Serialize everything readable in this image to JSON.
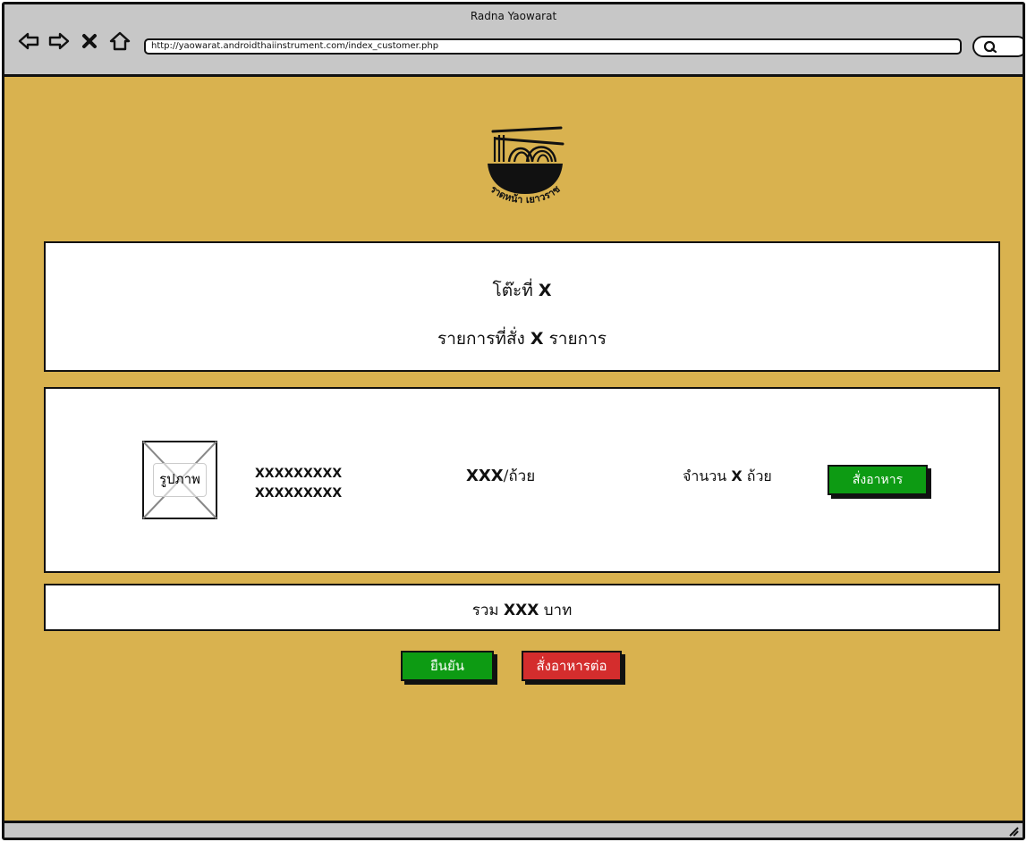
{
  "window": {
    "title": "Radna Yaowarat",
    "url": "http://yaowarat.androidthaiinstrument.com/index_customer.php"
  },
  "logo": {
    "text": "ราดหน้า เยาวราช",
    "icon": "noodle-bowl-icon"
  },
  "summary": {
    "table_prefix": "โต๊ะที่",
    "table_value": "X",
    "items_prefix": "รายการที่สั่ง",
    "items_value": "X",
    "items_suffix": "รายการ"
  },
  "order_item": {
    "image_label": "รูปภาพ",
    "name_line1": "XXXXXXXXX",
    "name_line2": "XXXXXXXXX",
    "price_value": "XXX",
    "price_unit": "/ถ้วย",
    "qty_prefix": "จำนวน",
    "qty_value": "X",
    "qty_suffix": "ถ้วย",
    "order_button": "สั่งอาหาร"
  },
  "total": {
    "prefix": "รวม",
    "value": "XXX",
    "suffix": "บาท"
  },
  "actions": {
    "confirm": "ยืนยัน",
    "order_more": "สั่งอาหารต่อ"
  },
  "colors": {
    "background": "#d9b24f",
    "green": "#0d9b13",
    "red": "#d42d2d"
  }
}
